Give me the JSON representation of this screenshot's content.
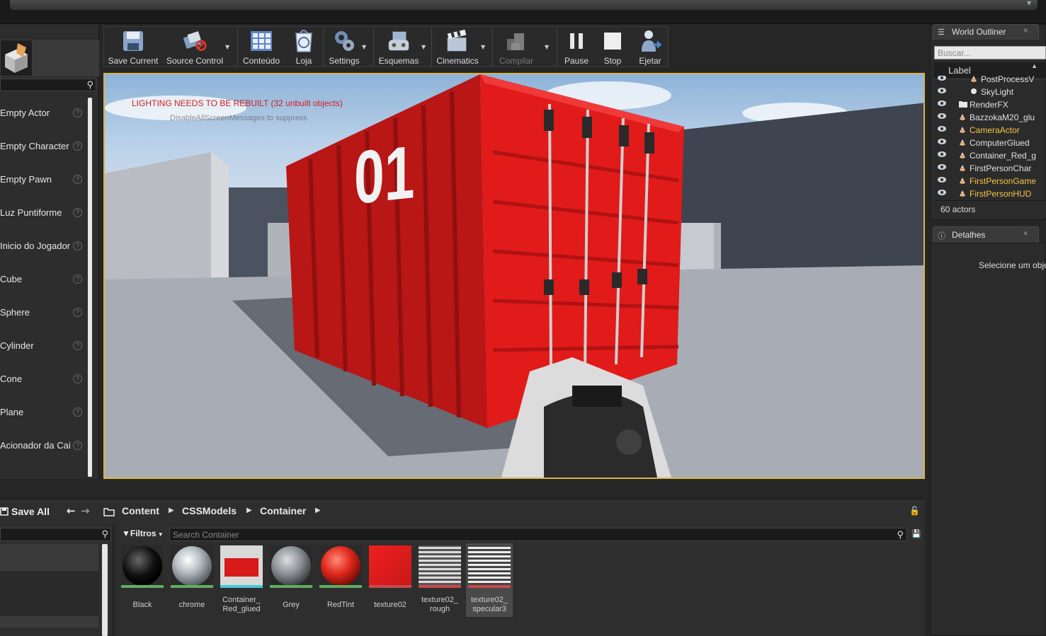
{
  "place_panel": {
    "items": [
      {
        "label": "Empty Actor"
      },
      {
        "label": "Empty Character"
      },
      {
        "label": "Empty Pawn"
      },
      {
        "label": "Luz Puntiforme"
      },
      {
        "label": "Inicio do Jogador"
      },
      {
        "label": "Cube"
      },
      {
        "label": "Sphere"
      },
      {
        "label": "Cylinder"
      },
      {
        "label": "Cone"
      },
      {
        "label": "Plane"
      },
      {
        "label": "Acionador da Cai"
      }
    ],
    "help_glyph": "?"
  },
  "toolbar": {
    "save_current": "Save Current",
    "source_control": "Source Control",
    "content": "Conteúdo",
    "store": "Loja",
    "settings": "Settings",
    "blueprints": "Esquemas",
    "cinematics": "Cinematics",
    "compile": "Compilar",
    "pause": "Pause",
    "stop": "Stop",
    "eject": "Ejetar"
  },
  "viewport": {
    "warning": "LIGHTING NEEDS TO BE REBUILT (32 unbuilt objects)",
    "sub_message": "DisableAllScreenMessages to suppress",
    "container_number": "01"
  },
  "world_outliner": {
    "tab_label": "World Outliner",
    "search_placeholder": "Buscar...",
    "column_label": "Label",
    "rows": [
      {
        "label": "PostProcessV",
        "highlight": false,
        "kind": "actor"
      },
      {
        "label": "SkyLight",
        "highlight": false,
        "kind": "light"
      },
      {
        "label": "RenderFX",
        "highlight": false,
        "kind": "folder"
      },
      {
        "label": "BazzokaM20_glu",
        "highlight": false,
        "kind": "actor"
      },
      {
        "label": "CameraActor",
        "highlight": true,
        "kind": "actor"
      },
      {
        "label": "ComputerGlued",
        "highlight": false,
        "kind": "actor"
      },
      {
        "label": "Container_Red_g",
        "highlight": false,
        "kind": "actor"
      },
      {
        "label": "FirstPersonChar",
        "highlight": false,
        "kind": "actor"
      },
      {
        "label": "FirstPersonGame",
        "highlight": true,
        "kind": "actor"
      },
      {
        "label": "FirstPersonHUD",
        "highlight": true,
        "kind": "actor"
      }
    ],
    "count": "60 actors"
  },
  "details": {
    "tab_label": "Detalhes",
    "empty_message": "Selecione um obje"
  },
  "content_browser": {
    "save_all": "Save All",
    "breadcrumbs": [
      "Content",
      "CSSModels",
      "Container"
    ],
    "filters_label": "Filtros",
    "search_placeholder": "Search Container",
    "assets": [
      {
        "name": "Black",
        "stripe": "#5fae5f"
      },
      {
        "name": "chrome",
        "stripe": "#5fae5f"
      },
      {
        "name": "Container_\nRed_glued",
        "stripe": "#49c6d9"
      },
      {
        "name": "Grey",
        "stripe": "#5fae5f"
      },
      {
        "name": "RedTint",
        "stripe": "#5fae5f"
      },
      {
        "name": "texture02",
        "stripe": "#c64a4a"
      },
      {
        "name": "texture02_\nrough",
        "stripe": "#c64a4a"
      },
      {
        "name": "texture02_\nspecular3",
        "stripe": "#c64a4a"
      }
    ]
  },
  "colors": {
    "accent_border": "#d8b447",
    "highlight_text": "#f5c542",
    "warning_red": "#d02020"
  }
}
